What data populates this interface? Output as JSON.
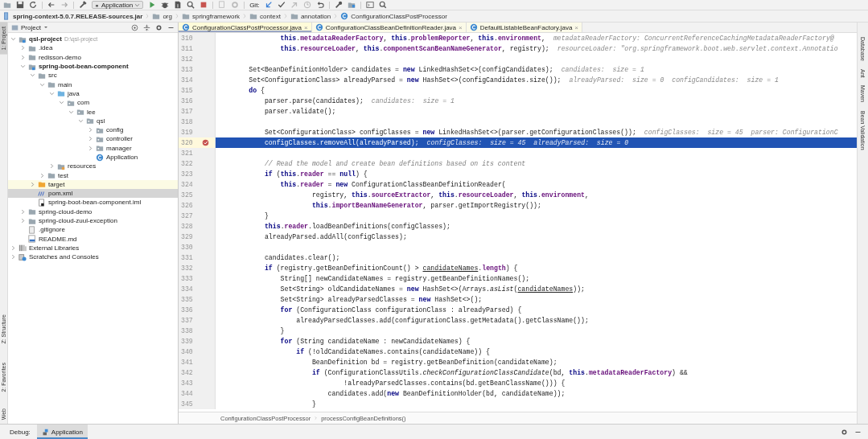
{
  "toolbar": {
    "run_config": "Application",
    "vcs_label": "Git:"
  },
  "nav_path": [
    {
      "label": "spring-context-5.0.7.RELEASE-sources.jar",
      "kind": "jar"
    },
    {
      "label": "org",
      "kind": "folder"
    },
    {
      "label": "springframework",
      "kind": "folder"
    },
    {
      "label": "context",
      "kind": "folder"
    },
    {
      "label": "annotation",
      "kind": "folder"
    },
    {
      "label": "ConfigurationClassPostProcessor",
      "kind": "class"
    }
  ],
  "left_strip": [
    {
      "label": "1: Project",
      "selected": true
    },
    {
      "label": "Z: Structure",
      "selected": false
    },
    {
      "label": "2: Favorites",
      "selected": false
    },
    {
      "label": "Web",
      "selected": false
    }
  ],
  "project_panel": {
    "title": "Project"
  },
  "project_tree": [
    {
      "label": "qsl-project",
      "path": "D:\\qsl-project",
      "kind": "module",
      "expanded": true,
      "selected": false,
      "highlighted": false,
      "children": [
        {
          "label": ".idea",
          "kind": "folder",
          "expanded": false,
          "selected": false,
          "highlighted": false
        },
        {
          "label": "redisson-demo",
          "kind": "folder",
          "expanded": false,
          "selected": false,
          "highlighted": false
        },
        {
          "label": "spring-boot-bean-component",
          "kind": "module",
          "expanded": true,
          "selected": false,
          "highlighted": false,
          "children": [
            {
              "label": "src",
              "kind": "folder",
              "expanded": true,
              "selected": false,
              "highlighted": false,
              "children": [
                {
                  "label": "main",
                  "kind": "folder",
                  "expanded": true,
                  "selected": false,
                  "highlighted": false,
                  "children": [
                    {
                      "label": "java",
                      "kind": "source",
                      "expanded": true,
                      "selected": false,
                      "highlighted": false,
                      "children": [
                        {
                          "label": "com",
                          "kind": "package",
                          "expanded": true,
                          "selected": false,
                          "highlighted": false,
                          "children": [
                            {
                              "label": "lee",
                              "kind": "package",
                              "expanded": true,
                              "selected": false,
                              "highlighted": false,
                              "children": [
                                {
                                  "label": "qsl",
                                  "kind": "package",
                                  "expanded": true,
                                  "selected": false,
                                  "highlighted": false,
                                  "children": [
                                    {
                                      "label": "config",
                                      "kind": "package",
                                      "expanded": false,
                                      "selected": false,
                                      "highlighted": false
                                    },
                                    {
                                      "label": "controller",
                                      "kind": "package",
                                      "expanded": false,
                                      "selected": false,
                                      "highlighted": false
                                    },
                                    {
                                      "label": "manager",
                                      "kind": "package",
                                      "expanded": false,
                                      "selected": false,
                                      "highlighted": false
                                    },
                                    {
                                      "label": "Application",
                                      "kind": "class",
                                      "selected": false,
                                      "highlighted": false
                                    }
                                  ]
                                }
                              ]
                            }
                          ]
                        }
                      ]
                    },
                    {
                      "label": "resources",
                      "kind": "resources",
                      "expanded": false,
                      "selected": false,
                      "highlighted": false
                    }
                  ]
                },
                {
                  "label": "test",
                  "kind": "folder",
                  "expanded": false,
                  "selected": false,
                  "highlighted": false
                }
              ]
            },
            {
              "label": "target",
              "kind": "excluded",
              "expanded": false,
              "selected": false,
              "highlighted": true
            },
            {
              "label": "pom.xml",
              "kind": "maven",
              "selected": true,
              "highlighted": false
            },
            {
              "label": "spring-boot-bean-component.iml",
              "kind": "iml",
              "selected": false,
              "highlighted": false
            }
          ]
        },
        {
          "label": "spring-cloud-demo",
          "kind": "folder",
          "expanded": false,
          "selected": false,
          "highlighted": false
        },
        {
          "label": "spring-cloud-zuul-exception",
          "kind": "folder",
          "expanded": false,
          "selected": false,
          "highlighted": false
        },
        {
          "label": ".gitignore",
          "kind": "file",
          "selected": false,
          "highlighted": false
        },
        {
          "label": "README.md",
          "kind": "markdown",
          "selected": false,
          "highlighted": false
        }
      ]
    },
    {
      "label": "External Libraries",
      "kind": "libraries",
      "expanded": false,
      "selected": false,
      "highlighted": false
    },
    {
      "label": "Scratches and Consoles",
      "kind": "scratches",
      "expanded": false,
      "selected": false,
      "highlighted": false
    }
  ],
  "editor_tabs": [
    {
      "label": "ConfigurationClassPostProcessor.java",
      "close": "×",
      "selected": true
    },
    {
      "label": "ConfigurationClassBeanDefinitionReader.java",
      "close": "×",
      "selected": false
    },
    {
      "label": "DefaultListableBeanFactory.java",
      "close": "×",
      "selected": false
    }
  ],
  "code_lines": [
    {
      "number": "310",
      "code": [
        {
          "text": "                this",
          "kind": "keyword"
        },
        ".",
        {
          "text": "metadataReaderFactory",
          "kind": "field"
        },
        ", ",
        {
          "text": "this",
          "kind": "keyword"
        },
        ".",
        {
          "text": "problemReporter",
          "kind": "field"
        },
        ", ",
        {
          "text": "this",
          "kind": "keyword"
        },
        ".",
        {
          "text": "environment",
          "kind": "field"
        },
        ","
      ],
      "hint": "metadataReaderFactory: ConcurrentReferenceCachingMetadataReaderFactory@",
      "selected": false,
      "breakpoint": false
    },
    {
      "number": "311",
      "code": [
        {
          "text": "                this",
          "kind": "keyword"
        },
        ".",
        {
          "text": "resourceLoader",
          "kind": "field"
        },
        ", ",
        {
          "text": "this",
          "kind": "keyword"
        },
        ".",
        {
          "text": "componentScanBeanNameGenerator",
          "kind": "field"
        },
        ", registry);"
      ],
      "hint": "resourceLoader: \"org.springframework.boot.web.servlet.context.Annotatio",
      "selected": false,
      "breakpoint": false
    },
    {
      "number": "312",
      "selected": false,
      "breakpoint": false
    },
    {
      "number": "313",
      "code": [
        "        Set<BeanDefinitionHolder> candidates = ",
        {
          "text": "new",
          "kind": "keyword"
        },
        " LinkedHashSet<>(configCandidates);"
      ],
      "hint": "candidates:  size = 1",
      "selected": false,
      "breakpoint": false
    },
    {
      "number": "314",
      "code": [
        "        Set<ConfigurationClass> alreadyParsed = ",
        {
          "text": "new",
          "kind": "keyword"
        },
        " HashSet<>(configCandidates.size());"
      ],
      "hint": "alreadyParsed:  size = 0  configCandidates:  size = 1",
      "selected": false,
      "breakpoint": false
    },
    {
      "number": "315",
      "code": [
        {
          "text": "        do",
          "kind": "keyword"
        },
        " {"
      ],
      "selected": false,
      "breakpoint": false
    },
    {
      "number": "316",
      "code": [
        "            parser.parse(candidates);"
      ],
      "hint": "candidates:  size = 1",
      "selected": false,
      "breakpoint": false
    },
    {
      "number": "317",
      "code": [
        "            parser.validate();"
      ],
      "selected": false,
      "breakpoint": false
    },
    {
      "number": "318",
      "selected": false,
      "breakpoint": false
    },
    {
      "number": "319",
      "code": [
        "            Set<ConfigurationClass> configClasses = ",
        {
          "text": "new",
          "kind": "keyword"
        },
        " LinkedHashSet<>(parser.getConfigurationClasses());"
      ],
      "hint": "configClasses:  size = 45  parser: ConfigurationC",
      "selected": false,
      "breakpoint": false
    },
    {
      "number": "320",
      "code": [
        "            configClasses.removeAll(alreadyParsed);"
      ],
      "hint": "configClasses:  size = 45  alreadyParsed:  size = 0",
      "selected": true,
      "breakpoint": true
    },
    {
      "number": "321",
      "selected": false,
      "breakpoint": false
    },
    {
      "number": "322",
      "code": [
        {
          "text": "            // Read the model and create bean definitions based on its content",
          "kind": "comment"
        }
      ],
      "selected": false,
      "breakpoint": false
    },
    {
      "number": "323",
      "code": [
        {
          "text": "            if",
          "kind": "keyword"
        },
        " (",
        {
          "text": "this",
          "kind": "keyword"
        },
        ".",
        {
          "text": "reader",
          "kind": "field"
        },
        " == ",
        {
          "text": "null",
          "kind": "keyword"
        },
        ") {"
      ],
      "selected": false,
      "breakpoint": false
    },
    {
      "number": "324",
      "code": [
        {
          "text": "                this",
          "kind": "keyword"
        },
        ".",
        {
          "text": "reader",
          "kind": "field"
        },
        " = ",
        {
          "text": "new",
          "kind": "keyword"
        },
        " ConfigurationClassBeanDefinitionReader("
      ],
      "selected": false,
      "breakpoint": false
    },
    {
      "number": "325",
      "code": [
        "                        registry, ",
        {
          "text": "this",
          "kind": "keyword"
        },
        ".",
        {
          "text": "sourceExtractor",
          "kind": "field"
        },
        ", ",
        {
          "text": "this",
          "kind": "keyword"
        },
        ".",
        {
          "text": "resourceLoader",
          "kind": "field"
        },
        ", ",
        {
          "text": "this",
          "kind": "keyword"
        },
        ".",
        {
          "text": "environment",
          "kind": "field"
        },
        ","
      ],
      "selected": false,
      "breakpoint": false
    },
    {
      "number": "326",
      "code": [
        {
          "text": "                        this",
          "kind": "keyword"
        },
        ".",
        {
          "text": "importBeanNameGenerator",
          "kind": "field"
        },
        ", parser.getImportRegistry());"
      ],
      "selected": false,
      "breakpoint": false
    },
    {
      "number": "327",
      "code": [
        "            }"
      ],
      "selected": false,
      "breakpoint": false
    },
    {
      "number": "328",
      "code": [
        {
          "text": "            this",
          "kind": "keyword"
        },
        ".",
        {
          "text": "reader",
          "kind": "field"
        },
        ".loadBeanDefinitions(configClasses);"
      ],
      "selected": false,
      "breakpoint": false
    },
    {
      "number": "329",
      "code": [
        "            alreadyParsed.addAll(configClasses);"
      ],
      "selected": false,
      "breakpoint": false
    },
    {
      "number": "330",
      "selected": false,
      "breakpoint": false
    },
    {
      "number": "331",
      "code": [
        "            candidates.clear();"
      ],
      "selected": false,
      "breakpoint": false
    },
    {
      "number": "332",
      "code": [
        {
          "text": "            if",
          "kind": "keyword"
        },
        " (registry.getBeanDefinitionCount() > ",
        {
          "text": "candidateNames",
          "kind": "underlined"
        },
        ".",
        {
          "text": "length",
          "kind": "field"
        },
        ") {"
      ],
      "selected": false,
      "breakpoint": false
    },
    {
      "number": "333",
      "code": [
        "                String[] newCandidateNames = registry.getBeanDefinitionNames();"
      ],
      "selected": false,
      "breakpoint": false
    },
    {
      "number": "334",
      "code": [
        "                Set<String> oldCandidateNames = ",
        {
          "text": "new",
          "kind": "keyword"
        },
        " HashSet<>(Arrays.",
        {
          "text": "asList",
          "kind": "static"
        },
        "(",
        {
          "text": "candidateNames",
          "kind": "underlined"
        },
        "));"
      ],
      "selected": false,
      "breakpoint": false
    },
    {
      "number": "335",
      "code": [
        "                Set<String> alreadyParsedClasses = ",
        {
          "text": "new",
          "kind": "keyword"
        },
        " HashSet<>();"
      ],
      "selected": false,
      "breakpoint": false
    },
    {
      "number": "336",
      "code": [
        {
          "text": "                for",
          "kind": "keyword"
        },
        " (ConfigurationClass configurationClass : alreadyParsed) {"
      ],
      "selected": false,
      "breakpoint": false
    },
    {
      "number": "337",
      "code": [
        "                    alreadyParsedClasses.add(configurationClass.getMetadata().getClassName());"
      ],
      "selected": false,
      "breakpoint": false
    },
    {
      "number": "338",
      "code": [
        "                }"
      ],
      "selected": false,
      "breakpoint": false
    },
    {
      "number": "339",
      "code": [
        {
          "text": "                for",
          "kind": "keyword"
        },
        " (String candidateName : newCandidateNames) {"
      ],
      "selected": false,
      "breakpoint": false
    },
    {
      "number": "340",
      "code": [
        {
          "text": "                    if",
          "kind": "keyword"
        },
        " (!oldCandidateNames.contains(candidateName)) {"
      ],
      "selected": false,
      "breakpoint": false
    },
    {
      "number": "341",
      "code": [
        "                        BeanDefinition bd = registry.getBeanDefinition(candidateName);"
      ],
      "selected": false,
      "breakpoint": false
    },
    {
      "number": "342",
      "code": [
        {
          "text": "                        if",
          "kind": "keyword"
        },
        " (ConfigurationClassUtils.",
        {
          "text": "checkConfigurationClassCandidate",
          "kind": "static"
        },
        "(bd, ",
        {
          "text": "this",
          "kind": "keyword"
        },
        ".",
        {
          "text": "metadataReaderFactory",
          "kind": "field"
        },
        ") &&"
      ],
      "selected": false,
      "breakpoint": false
    },
    {
      "number": "343",
      "code": [
        "                                !alreadyParsedClasses.contains(bd.getBeanClassName())) {"
      ],
      "selected": false,
      "breakpoint": false
    },
    {
      "number": "344",
      "code": [
        "                            candidates.add(",
        {
          "text": "new",
          "kind": "keyword"
        },
        " BeanDefinitionHolder(bd, candidateName));"
      ],
      "selected": false,
      "breakpoint": false
    },
    {
      "number": "345",
      "code": [
        "                        }"
      ],
      "selected": false,
      "breakpoint": false
    }
  ],
  "editor_breadcrumb": [
    "ConfigurationClassPostProcessor",
    "processConfigBeanDefinitions()"
  ],
  "right_strip": [
    {
      "label": "Database",
      "selected": false
    },
    {
      "label": "Ant",
      "selected": false
    },
    {
      "label": "Maven",
      "selected": false
    },
    {
      "label": "Bean Validation",
      "selected": false
    }
  ],
  "debug": {
    "label": "Debug:",
    "tabs": [
      {
        "label": "Application",
        "selected": true
      }
    ]
  }
}
